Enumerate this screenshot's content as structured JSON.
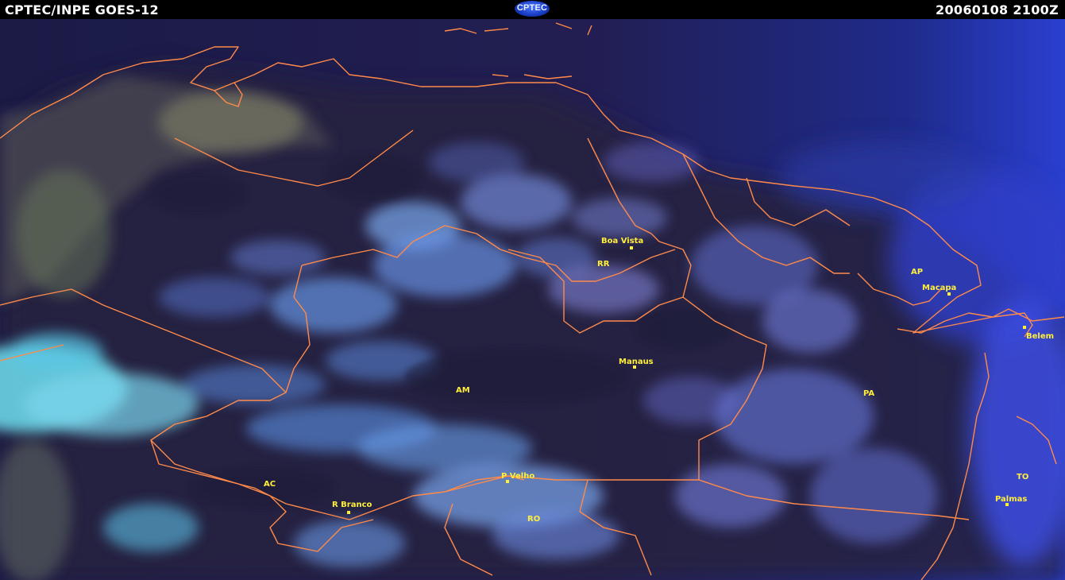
{
  "header": {
    "source": "CPTEC/INPE  GOES-12",
    "datetime": "20060108  2100Z",
    "logo_text": "CPTEC"
  },
  "colors": {
    "background_sea": "#1a1a4a",
    "cloud_light": "#6aa0f2",
    "cloud_bright": "#a0e8f6",
    "borders": "#ff8a4a",
    "labels": "#ffef3a"
  },
  "map": {
    "cities": [
      {
        "name": "Boa Vista"
      },
      {
        "name": "Macapa"
      },
      {
        "name": "Belem"
      },
      {
        "name": "Manaus"
      },
      {
        "name": "P Velho"
      },
      {
        "name": "R Branco"
      },
      {
        "name": "Palmas"
      }
    ],
    "states": [
      {
        "abbr": "RR"
      },
      {
        "abbr": "AP"
      },
      {
        "abbr": "AM"
      },
      {
        "abbr": "PA"
      },
      {
        "abbr": "AC"
      },
      {
        "abbr": "RO"
      },
      {
        "abbr": "TO"
      }
    ]
  }
}
